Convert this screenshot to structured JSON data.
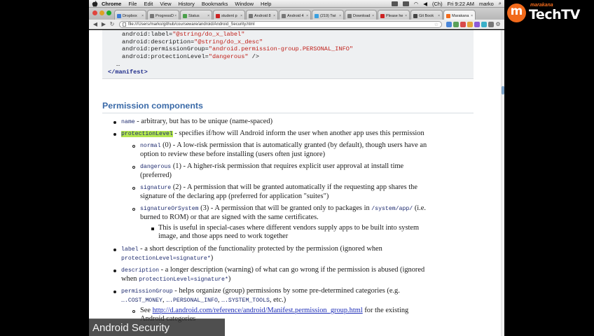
{
  "menubar": {
    "items": [
      "Chrome",
      "File",
      "Edit",
      "View",
      "History",
      "Bookmarks",
      "Window",
      "Help"
    ],
    "clock": "Fri 9:22 AM",
    "user": "marko",
    "battery_label": "(Ch)"
  },
  "tabs": [
    {
      "label": "Dropbox",
      "color": "#3d7bd6"
    },
    {
      "label": "ProgressD",
      "color": "#777777"
    },
    {
      "label": "Status",
      "color": "#4aa04a"
    },
    {
      "label": "student p",
      "color": "#cc2222"
    },
    {
      "label": "Android 8",
      "color": "#777777"
    },
    {
      "label": "Android 4",
      "color": "#777777"
    },
    {
      "label": "(219) Twi",
      "color": "#3aa0e0"
    },
    {
      "label": "Download",
      "color": "#777777"
    },
    {
      "label": "Please he",
      "color": "#cc2222"
    },
    {
      "label": "Git Book",
      "color": "#444444"
    },
    {
      "label": "Marakana",
      "color": "#f26a1b"
    }
  ],
  "url": "file:///Users/marko/github/courseware/android/Android_Security.html",
  "code_lines": [
    {
      "attr": "android:label=",
      "value": "\"@string/do_x_label\""
    },
    {
      "attr": "android:description=",
      "value": "\"@string/do_x_desc\""
    },
    {
      "attr": "android:permissionGroup=",
      "value": "\"android.permission-group.PERSONAL_INFO\""
    },
    {
      "attr": "android:protectionLevel=",
      "value": "\"dangerous\"",
      "suffix": " />"
    }
  ],
  "code_ellipsis": "…",
  "code_close": "</manifest>",
  "heading": "Permission components",
  "content": {
    "name": {
      "code": "name",
      "text": " - arbitrary, but has to be unique (name-spaced)"
    },
    "protection": {
      "code": "protectionLevel",
      "text": " - specifies if/how will Android inform the user when another app uses this permission"
    },
    "normal": {
      "code": "normal",
      "l1": " (0) - A low-risk permission that is automatically granted (by default), though users have an",
      "l2": "option to review these before installing (users often just ignore)"
    },
    "dangerous": {
      "code": "dangerous",
      "l1": " (1) - A higher-risk permission that requires explicit user approval at install time",
      "l2": "(preferred)"
    },
    "signature": {
      "code": "signature",
      "l1": " (2) - A permission that will be granted automatically if the requesting app shares the",
      "l2": "signature of the declaring app (preferred for application \"suites\")"
    },
    "sigsys": {
      "code": "signatureOrSystem",
      "l1a": " (3) - A permission that will be granted only to packages in ",
      "code2": "/system/app/",
      "l1b": " (i.e.",
      "l2": "burned to ROM) or that are signed with the same certificates."
    },
    "special": {
      "l1": "This is useful in special-cases where different vendors supply apps to be built into system",
      "l2": "image, and those apps need to work together"
    },
    "label": {
      "code": "label",
      "l1": " - a short description of the functionality protected by the permission (ignored when",
      "code2": "protectionLevel=signature*",
      "l2b": ")"
    },
    "description": {
      "code": "description",
      "l1": " - a longer description (warning) of what can go wrong if the permission is abused (ignored",
      "l2a": "when ",
      "code2": "protectionLevel=signature*",
      "l2b": ")"
    },
    "permgroup": {
      "code": "permissionGroup",
      "l1": " - helps organize (group) permissions by some pre-determined categories (e.g.",
      "c1": "….COST_MONEY",
      "sep1": ", ",
      "c2": "….PERSONAL_INFO",
      "sep2": ", ",
      "c3": "….SYSTEM_TOOLS",
      "tail": ", etc.)"
    },
    "see": {
      "pre": "See ",
      "link": "http://d.android.com/reference/android/Manifest.permission_group.html",
      "post": " for the existing",
      "l2": "Android categories"
    }
  },
  "lower_third": "Android Security",
  "logo": {
    "small": "marakana",
    "big": "TechTV",
    "mark": "m"
  }
}
